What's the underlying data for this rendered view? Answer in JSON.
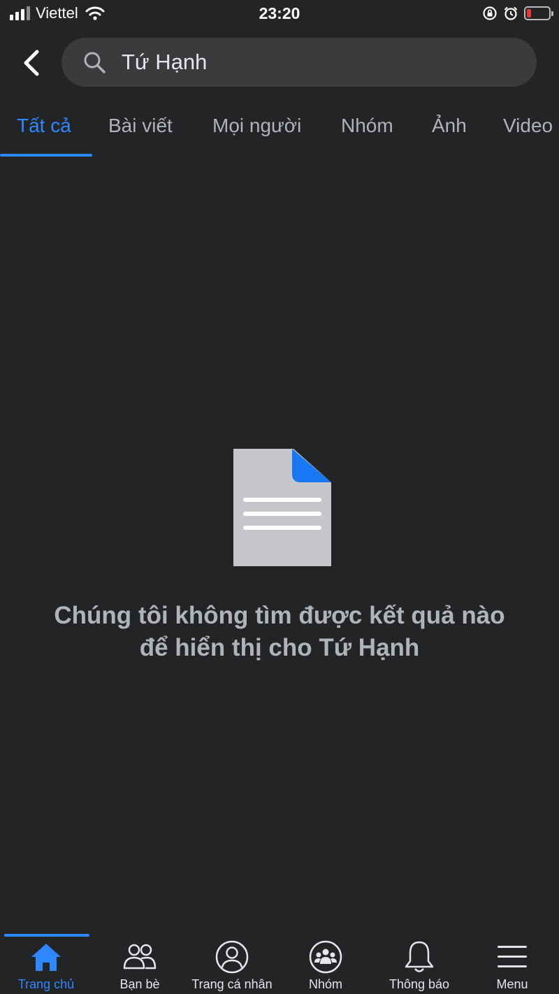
{
  "status_bar": {
    "carrier": "Viettel",
    "time": "23:20"
  },
  "search": {
    "query": "Tứ Hạnh"
  },
  "tabs": [
    {
      "label": "Tất cả",
      "active": true
    },
    {
      "label": "Bài viết",
      "active": false
    },
    {
      "label": "Mọi người",
      "active": false
    },
    {
      "label": "Nhóm",
      "active": false
    },
    {
      "label": "Ảnh",
      "active": false
    },
    {
      "label": "Video",
      "active": false
    }
  ],
  "empty_state": {
    "icon": "document-icon",
    "line1": "Chúng tôi không tìm được kết quả nào",
    "line2": "để hiển thị cho Tứ Hạnh"
  },
  "bottom_nav": [
    {
      "label": "Trang chủ",
      "icon": "home-icon",
      "active": true
    },
    {
      "label": "Bạn bè",
      "icon": "friends-icon",
      "active": false
    },
    {
      "label": "Trang cá nhân",
      "icon": "profile-icon",
      "active": false
    },
    {
      "label": "Nhóm",
      "icon": "groups-icon",
      "active": false
    },
    {
      "label": "Thông báo",
      "icon": "bell-icon",
      "active": false
    },
    {
      "label": "Menu",
      "icon": "menu-icon",
      "active": false
    }
  ],
  "colors": {
    "background": "#232426",
    "accent": "#2d88ff",
    "search_fill": "#3a3b3c",
    "muted_text": "#b0b3b8",
    "battery_low": "#e53935"
  }
}
